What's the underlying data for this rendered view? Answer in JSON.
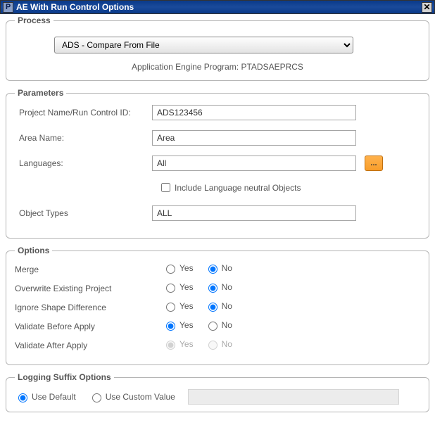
{
  "title": "AE With Run Control Options",
  "titlebar_icon_letter": "P",
  "close_glyph": "✕",
  "process": {
    "legend": "Process",
    "selected": "ADS - Compare From File",
    "program_line": "Application Engine Program: PTADSAEPRCS"
  },
  "parameters": {
    "legend": "Parameters",
    "project_label": "Project Name/Run Control ID:",
    "project_value": "ADS123456",
    "area_label": "Area Name:",
    "area_value": "Area",
    "languages_label": "Languages:",
    "languages_value": "All",
    "lang_button": "...",
    "include_neutral_label": "Include Language neutral Objects",
    "include_neutral_checked": false,
    "object_types_label": "Object Types",
    "object_types_value": "ALL"
  },
  "options": {
    "legend": "Options",
    "yes": "Yes",
    "no": "No",
    "rows": [
      {
        "label": "Merge",
        "value": "No",
        "disabled": false
      },
      {
        "label": "Overwrite Existing Project",
        "value": "No",
        "disabled": false
      },
      {
        "label": "Ignore Shape Difference",
        "value": "No",
        "disabled": false
      },
      {
        "label": "Validate Before Apply",
        "value": "Yes",
        "disabled": false
      },
      {
        "label": "Validate After Apply",
        "value": "Yes",
        "disabled": true
      }
    ]
  },
  "logging": {
    "legend": "Logging Suffix Options",
    "use_default": "Use Default",
    "use_custom": "Use Custom Value",
    "selected": "default",
    "custom_value": ""
  }
}
